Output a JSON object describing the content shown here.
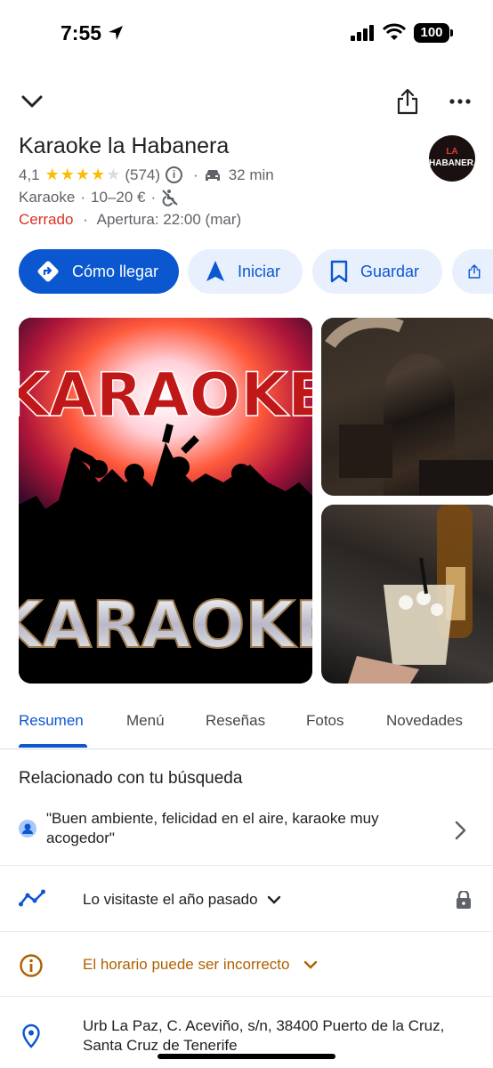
{
  "status_bar": {
    "time": "7:55",
    "battery": "100"
  },
  "header": {
    "back_icon": "chevron-down-icon",
    "share_icon": "share-icon",
    "more_icon": "more-icon"
  },
  "place": {
    "name": "Karaoke la Habanera",
    "rating": "4,1",
    "stars_value": 4.1,
    "review_count": "(574)",
    "drive_time": "32 min",
    "category": "Karaoke",
    "price": "10–20 €",
    "status": "Cerrado",
    "opening": "Apertura: 22:00 (mar)",
    "avatar_line1": "LA",
    "avatar_line2": "HABANERA"
  },
  "actions": [
    {
      "label": "Cómo llegar",
      "icon": "directions-icon"
    },
    {
      "label": "Iniciar",
      "icon": "navigation-icon"
    },
    {
      "label": "Guardar",
      "icon": "bookmark-icon"
    },
    {
      "label": "",
      "icon": "share-icon"
    }
  ],
  "photos": {
    "main_text_top": "KARAOKE",
    "main_text_bottom": "KARAOKE"
  },
  "tabs": [
    "Resumen",
    "Menú",
    "Reseñas",
    "Fotos",
    "Novedades"
  ],
  "related": {
    "title": "Relacionado con tu búsqueda",
    "quote": "\"Buen ambiente, felicidad en el aire, karaoke muy acogedor\""
  },
  "rows": {
    "visited": "Lo visitaste el año pasado",
    "hours_warning": "El horario puede ser incorrecto",
    "address": "Urb La Paz, C. Aceviño, s/n, 38400 Puerto de la Cruz, Santa Cruz de Tenerife"
  },
  "colors": {
    "accent": "#0b57d0",
    "closed": "#d93025",
    "warning": "#b06000",
    "star": "#fbbc04"
  }
}
